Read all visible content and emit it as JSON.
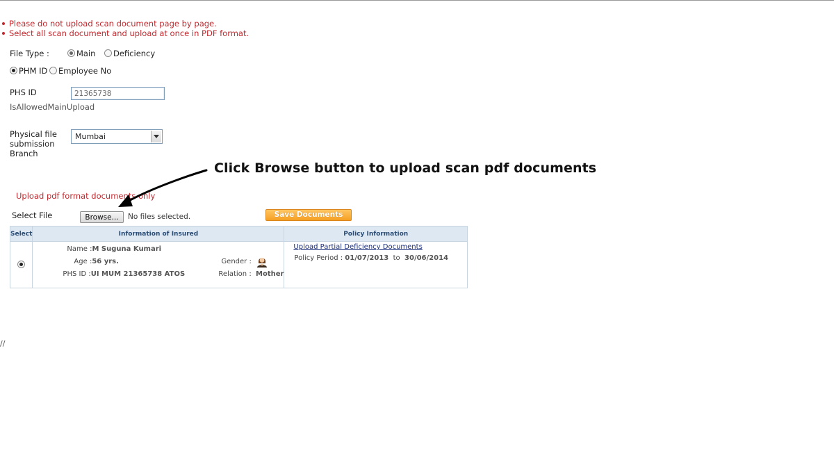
{
  "notes": [
    "Please do not upload scan document page by page.",
    "Select all scan document and upload at once in PDF format."
  ],
  "file_type": {
    "label": "File Type :",
    "options": [
      "Main",
      "Deficiency"
    ],
    "selected": "Main"
  },
  "id_type": {
    "options": [
      "PHM ID",
      "Employee No"
    ],
    "selected": "PHM ID"
  },
  "phs_id": {
    "label": "PHS ID",
    "value": "21365738",
    "hint": "IsAllowedMainUpload"
  },
  "branch": {
    "label_lines": [
      "Physical file",
      "submission",
      "Branch"
    ],
    "selected": "Mumbai"
  },
  "callout": "Click Browse button to upload scan pdf documents",
  "upload_note": "Upload pdf format documents only",
  "select_file": {
    "label": "Select File",
    "browse_label": "Browse...",
    "status": "No files selected."
  },
  "save_button": "Save Documents",
  "table": {
    "headers": [
      "Select",
      "Information of Insured",
      "Policy Information"
    ],
    "row": {
      "name_label": "Name :",
      "name": "M Suguna Kumari",
      "age_label": "Age :",
      "age": "56  yrs.",
      "phs_label": "PHS ID :",
      "phs": "UI MUM 21365738 ATOS",
      "gender_label": "Gender :",
      "relation_label": "Relation :",
      "relation": "Mother",
      "policy_link": "Upload Partial Deficiency Documents",
      "period_label": "Policy Period :",
      "period_from": "01/07/2013",
      "period_to_label": "to",
      "period_to": "30/06/2014"
    }
  },
  "footer_text": "//",
  "colors": {
    "note_red": "#c0282d",
    "header_bg": "#dde8f3",
    "save_orange": "#f5a023",
    "link_blue": "#1c2f7a"
  }
}
